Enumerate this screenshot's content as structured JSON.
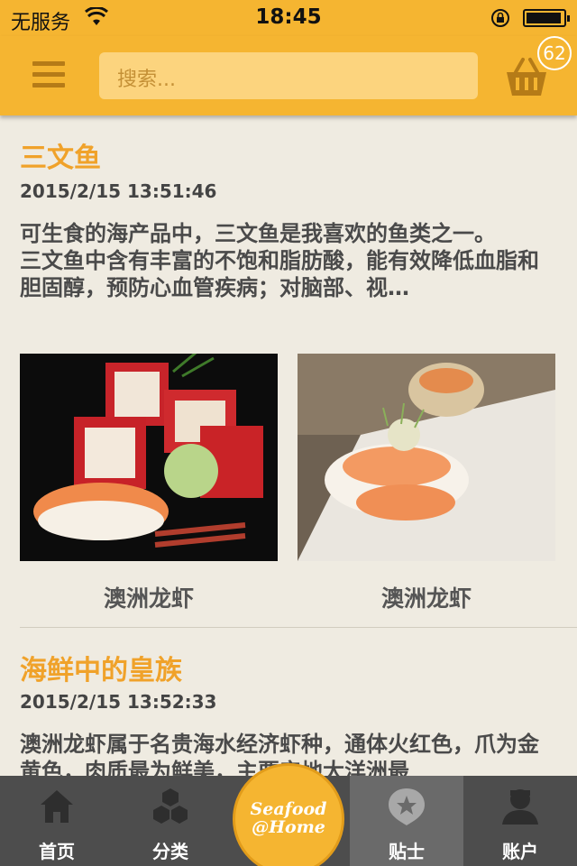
{
  "status_bar": {
    "carrier": "无服务",
    "time": "18:45"
  },
  "nav": {
    "search_placeholder": "搜索...",
    "cart_count": "62"
  },
  "articles": [
    {
      "title": "三文鱼",
      "date": "2015/2/15 13:51:46",
      "body": "可生食的海产品中，三文鱼是我喜欢的鱼类之一。\n三文鱼中含有丰富的不饱和脂肪酸，能有效降低血脂和胆固醇，预防心血管疾病；对脑部、视…",
      "images": [
        {
          "caption": "澳洲龙虾"
        },
        {
          "caption": "澳洲龙虾"
        }
      ]
    },
    {
      "title": "海鲜中的皇族",
      "date": "2015/2/15 13:52:33",
      "body": "澳洲龙虾属于名贵海水经济虾种，通体火红色，爪为金黄色，肉质最为鲜美，主要产地大洋洲最"
    }
  ],
  "tab_bar": {
    "tabs": [
      {
        "label": "首页"
      },
      {
        "label": "分类"
      },
      {
        "label": "贴士"
      },
      {
        "label": "账户"
      }
    ],
    "active": "贴士",
    "logo_text": "Seafood @Home"
  },
  "colors": {
    "accent": "#f5b531",
    "title": "#f0a22a",
    "tab_bar": "#4d4d4d",
    "background": "#efebe1"
  }
}
